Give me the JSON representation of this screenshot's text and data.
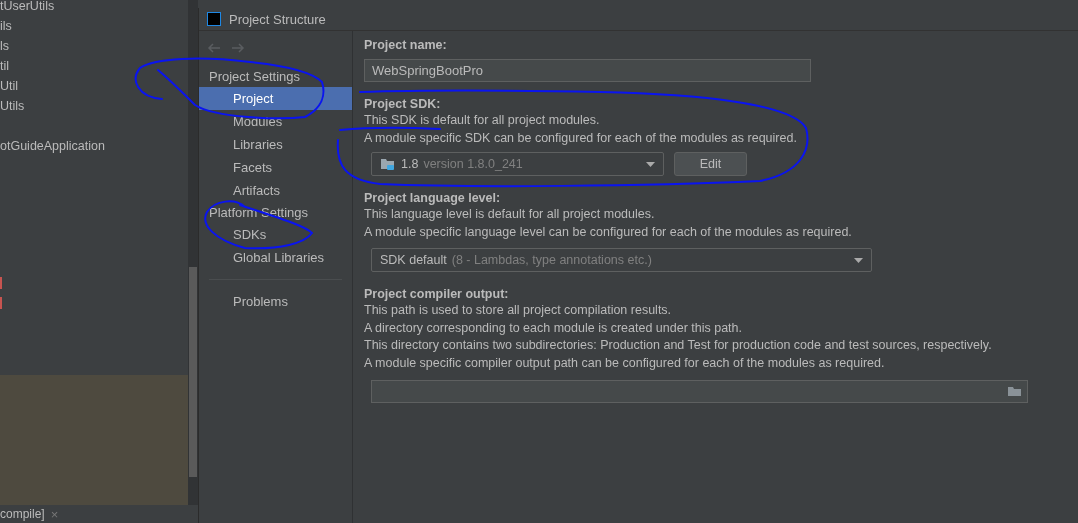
{
  "ide": {
    "project_tree": [
      "tUserUtils",
      "ils",
      "ls",
      "til",
      "Util",
      "Utils",
      "otGuideApplication"
    ],
    "bottom_tab": {
      "label": "compile]",
      "close": "×"
    }
  },
  "dialog": {
    "title": "Project Structure",
    "sidebar": [
      {
        "kind": "header",
        "label": "Project Settings"
      },
      {
        "kind": "item",
        "label": "Project",
        "selected": true
      },
      {
        "kind": "item",
        "label": "Modules",
        "selected": false
      },
      {
        "kind": "item",
        "label": "Libraries",
        "selected": false
      },
      {
        "kind": "item",
        "label": "Facets",
        "selected": false
      },
      {
        "kind": "item",
        "label": "Artifacts",
        "selected": false
      },
      {
        "kind": "header",
        "label": "Platform Settings"
      },
      {
        "kind": "item",
        "label": "SDKs",
        "selected": false
      },
      {
        "kind": "item",
        "label": "Global Libraries",
        "selected": false
      },
      {
        "kind": "separator"
      },
      {
        "kind": "item",
        "label": "Problems",
        "selected": false
      }
    ],
    "content": {
      "project_name": {
        "label": "Project name:",
        "value": "WebSpringBootPro"
      },
      "project_sdk": {
        "label": "Project SDK:",
        "description": [
          "This SDK is default for all project modules.",
          "A module specific SDK can be configured for each of the modules as required."
        ],
        "dropdown": {
          "value": "1.8",
          "detail": "version 1.8.0_241"
        },
        "edit_button": "Edit"
      },
      "language_level": {
        "label": "Project language level:",
        "description": [
          "This language level is default for all project modules.",
          "A module specific language level can be configured for each of the modules as required."
        ],
        "dropdown": {
          "value": "SDK default",
          "detail": "(8 - Lambdas, type annotations etc.)"
        }
      },
      "compiler_output": {
        "label": "Project compiler output:",
        "description": [
          "This path is used to store all project compilation results.",
          "A directory corresponding to each module is created under this path.",
          "This directory contains two subdirectories: Production and Test for production code and test sources, respectively.",
          "A module specific compiler output path can be configured for each of the modules as required."
        ]
      }
    }
  },
  "annotations": [
    {
      "kind": "loop"
    },
    {
      "kind": "loop"
    },
    {
      "kind": "loop"
    }
  ]
}
